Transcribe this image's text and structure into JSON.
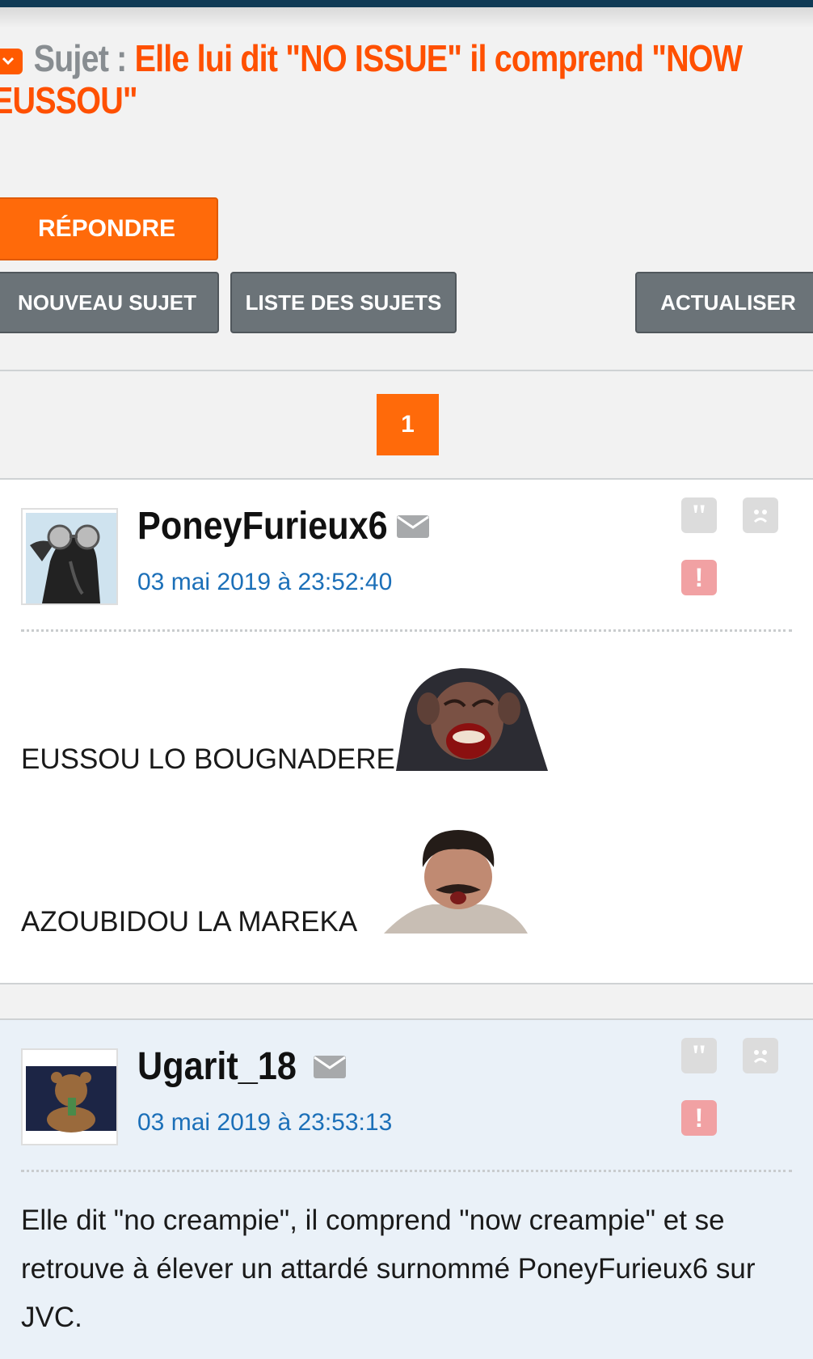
{
  "topic": {
    "label": "Sujet :",
    "title": "Elle lui dit \"NO ISSUE\" il comprend \"NOW EUSSOU\""
  },
  "actions": {
    "reply": "RÉPONDRE",
    "new_topic": "NOUVEAU SUJET",
    "topic_list": "LISTE DES SUJETS",
    "refresh": "ACTUALISER"
  },
  "pagination": {
    "current": "1"
  },
  "posts": [
    {
      "author": "PoneyFurieux6",
      "date": "03 mai 2019 à 23:52:40",
      "lines": [
        "EUSSOU LO BOUGNADERE",
        "AZOUBIDOU LA MAREKA"
      ],
      "stickers": [
        "laughing-monkey-sticker",
        "mustache-man-sticker"
      ]
    },
    {
      "author": "Ugarit_18",
      "date": "03 mai 2019 à 23:53:13",
      "text": "Elle dit \"no creampie\", il comprend \"now creampie\" et se retrouve à élever un attardé surnommé PoneyFurieux6 sur JVC."
    }
  ],
  "icons": {
    "quote": "quote-icon",
    "sad": "sad-face-icon",
    "alert": "alert-icon",
    "mail": "mail-icon"
  },
  "colors": {
    "accent": "#ff6a0a",
    "title": "#ff5000",
    "button_grey": "#6b7378",
    "date": "#1b6fb8",
    "post_alt_bg": "#eaf1f8"
  }
}
